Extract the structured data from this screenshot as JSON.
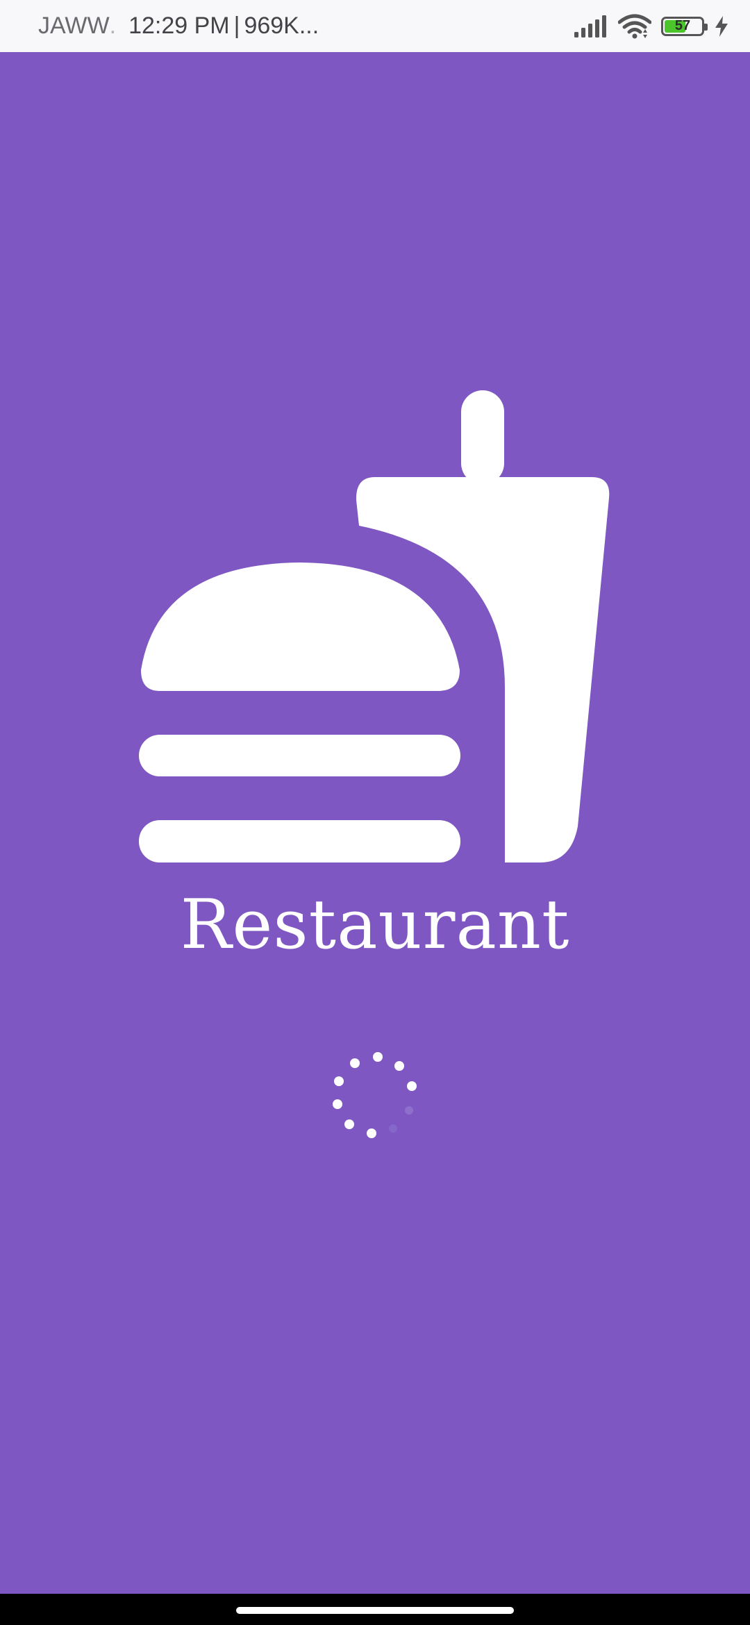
{
  "status_bar": {
    "carrier": "JAWW",
    "carrier_fade": ".",
    "time": "12:29 PM",
    "separator": "|",
    "network_speed": "969K...",
    "battery_level": "57",
    "battery_fill_fraction": 0.57,
    "icons": [
      "signal-icon",
      "wifi-icon",
      "battery-icon",
      "charging-icon"
    ]
  },
  "splash": {
    "logo_icon": "burger-and-drink-icon",
    "title": "Restaurant",
    "loading_indicator": "dotted-spinner"
  },
  "colors": {
    "background": "#7E57C2",
    "status_bar_bg": "#F8F8FA",
    "foreground": "#FFFFFF",
    "battery_fill": "#4CC42C",
    "nav_bar_bg": "#000000"
  }
}
